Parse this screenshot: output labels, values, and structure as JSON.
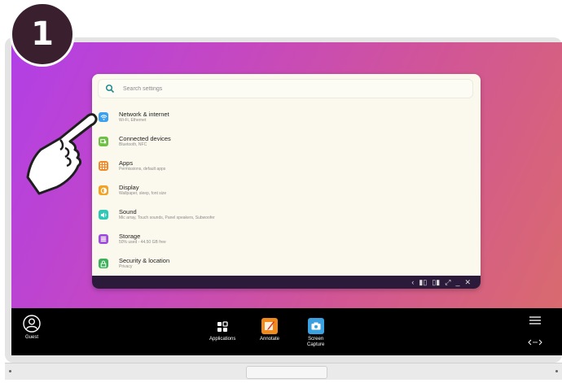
{
  "step_number": "1",
  "search": {
    "placeholder": "Search settings"
  },
  "settings_items": [
    {
      "title": "Network & internet",
      "subtitle": "Wi-Fi, Ethernet",
      "icon": "wifi-icon",
      "color": "#3d9ff0"
    },
    {
      "title": "Connected devices",
      "subtitle": "Bluetooth, NFC",
      "icon": "devices-icon",
      "color": "#6cc045"
    },
    {
      "title": "Apps",
      "subtitle": "Permissions, default apps",
      "icon": "apps-grid-icon",
      "color": "#f08a28"
    },
    {
      "title": "Display",
      "subtitle": "Wallpaper, sleep, font size",
      "icon": "brightness-icon",
      "color": "#f2a324"
    },
    {
      "title": "Sound",
      "subtitle": "Mic array, Touch sounds, Panel speakers, Subwoofer",
      "icon": "volume-icon",
      "color": "#2ec9b5"
    },
    {
      "title": "Storage",
      "subtitle": "50% used - 44.50 GB free",
      "icon": "storage-icon",
      "color": "#a24be0"
    },
    {
      "title": "Security & location",
      "subtitle": "Privacy",
      "icon": "lock-icon",
      "color": "#3bb25a"
    }
  ],
  "taskbar": {
    "user_label": "Guest",
    "applications_label": "Applications",
    "annotate_label": "Annotate",
    "screen_capture_label": "Screen\nCapture"
  }
}
